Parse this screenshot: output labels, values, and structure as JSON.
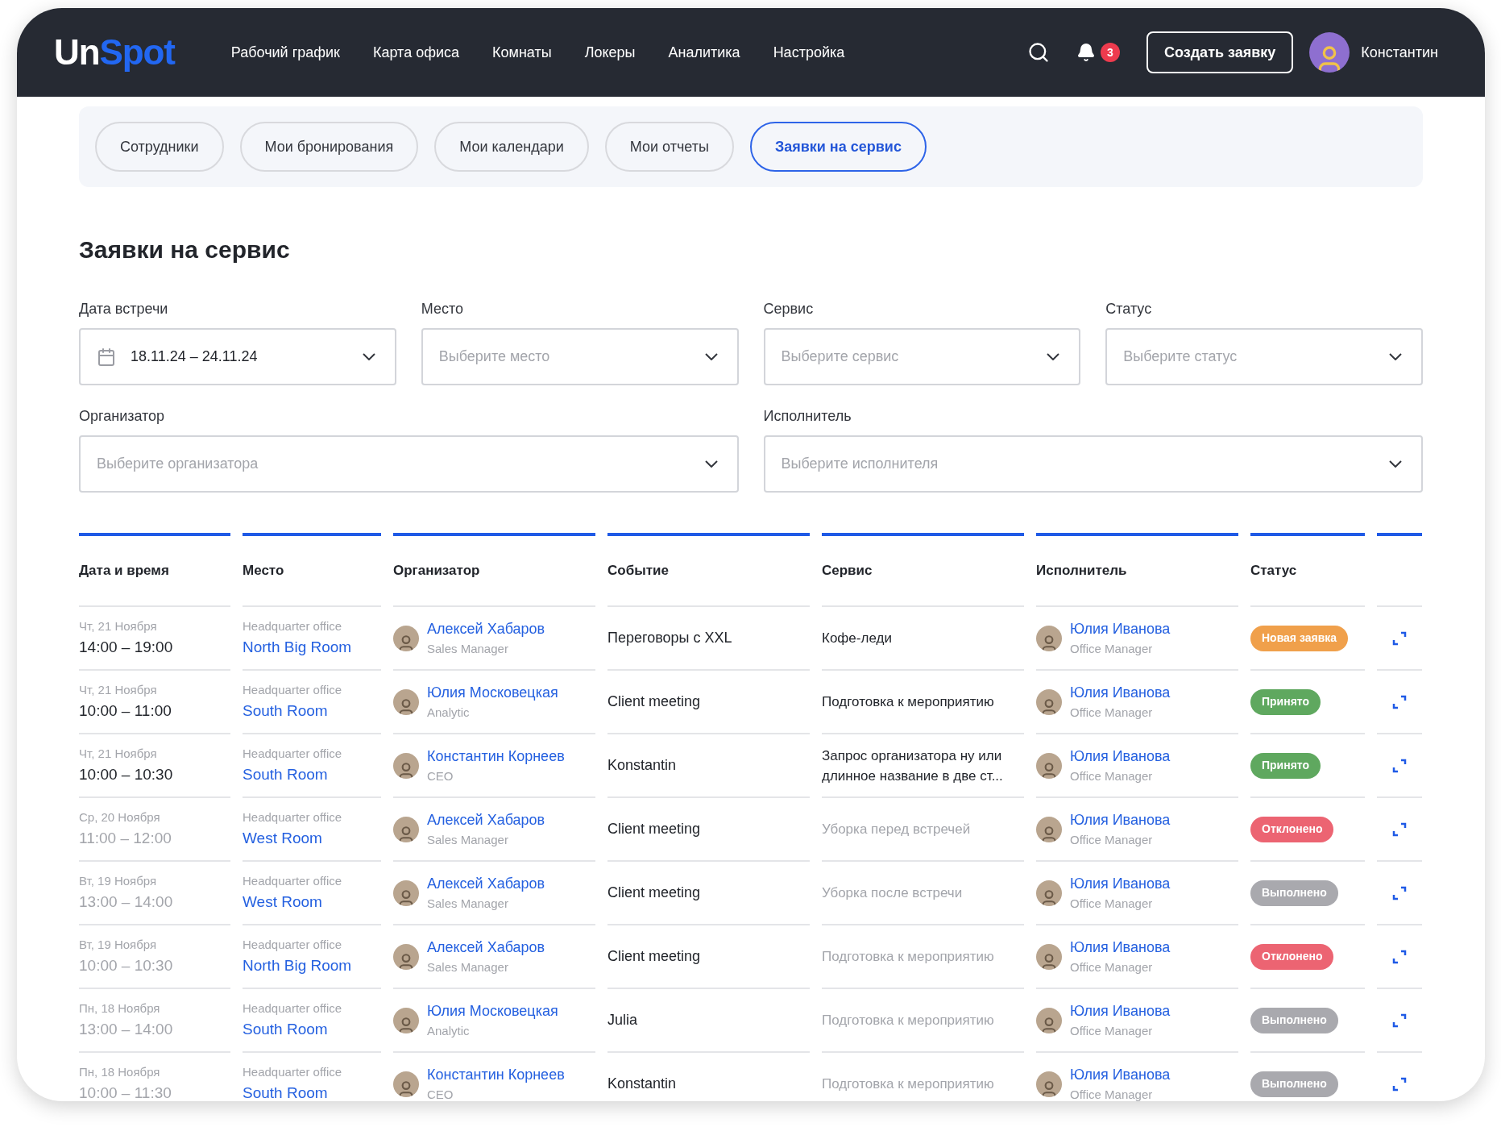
{
  "header": {
    "logo_start": "Un",
    "logo_end": "Spot",
    "nav": [
      "Рабочий график",
      "Карта офиса",
      "Комнаты",
      "Локеры",
      "Аналитика",
      "Настройка"
    ],
    "notification_count": "3",
    "create_button": "Создать заявку",
    "user_name": "Константин"
  },
  "tabs": [
    {
      "label": "Сотрудники",
      "selected": false
    },
    {
      "label": "Мои бронирования",
      "selected": false
    },
    {
      "label": "Мои календари",
      "selected": false
    },
    {
      "label": "Мои отчеты",
      "selected": false
    },
    {
      "label": "Заявки на сервис",
      "selected": true
    }
  ],
  "title": "Заявки на сервис",
  "filters": [
    {
      "label": "Дата встречи",
      "value": "18.11.24 – 24.11.24",
      "kind": "date"
    },
    {
      "label": "Место",
      "placeholder": "Выберите место",
      "kind": "select"
    },
    {
      "label": "Сервис",
      "placeholder": "Выберите сервис",
      "kind": "select"
    },
    {
      "label": "Статус",
      "placeholder": "Выберите статус",
      "kind": "select"
    },
    {
      "label": "Организатор",
      "placeholder": "Выберите организатора",
      "kind": "wide"
    },
    {
      "label": "Исполнитель",
      "placeholder": "Выберите исполнителя",
      "kind": "wide"
    }
  ],
  "table": {
    "columns": [
      "Дата и время",
      "Место",
      "Организатор",
      "Событие",
      "Сервис",
      "Исполнитель",
      "Статус"
    ],
    "rows": [
      {
        "muted": false,
        "day": "Чт, 21 Ноября",
        "time": "14:00 – 19:00",
        "office": "Headquarter office",
        "room": "North Big Room",
        "organizer": "Алексей Хабаров",
        "organizer_role": "Sales Manager",
        "event": "Переговоры с XXL",
        "service": "Кофе-леди",
        "executor": "Юлия Иванова",
        "executor_role": "Office Manager",
        "status": "Новая заявка",
        "color": "#f0a04b"
      },
      {
        "muted": false,
        "day": "Чт, 21 Ноября",
        "time": "10:00 – 11:00",
        "office": "Headquarter office",
        "room": "South Room",
        "organizer": "Юлия Московецкая",
        "organizer_role": "Analytic",
        "event": "Client meeting",
        "service": "Подготовка к мероприятию",
        "executor": "Юлия Иванова",
        "executor_role": "Office Manager",
        "status": "Принято",
        "color": "#5fa85f"
      },
      {
        "muted": false,
        "day": "Чт, 21 Ноября",
        "time": "10:00 – 10:30",
        "office": "Headquarter office",
        "room": "South Room",
        "organizer": "Константин Корнеев",
        "organizer_role": "CEO",
        "event": "Konstantin",
        "service": "Запрос организатора ну или длинное название в две ст...",
        "executor": "Юлия Иванова",
        "executor_role": "Office Manager",
        "status": "Принято",
        "color": "#5fa85f"
      },
      {
        "muted": true,
        "day": "Ср, 20 Ноября",
        "time": "11:00 – 12:00",
        "office": "Headquarter office",
        "room": "West Room",
        "organizer": "Алексей Хабаров",
        "organizer_role": "Sales Manager",
        "event": "Client meeting",
        "service": "Уборка перед встречей",
        "executor": "Юлия Иванова",
        "executor_role": "Office Manager",
        "status": "Отклонено",
        "color": "#ec6472"
      },
      {
        "muted": true,
        "day": "Вт, 19 Ноября",
        "time": "13:00 – 14:00",
        "office": "Headquarter office",
        "room": "West Room",
        "organizer": "Алексей Хабаров",
        "organizer_role": "Sales Manager",
        "event": "Client meeting",
        "service": "Уборка после встречи",
        "executor": "Юлия Иванова",
        "executor_role": "Office Manager",
        "status": "Выполнено",
        "color": "#a9a9ae"
      },
      {
        "muted": true,
        "day": "Вт, 19 Ноября",
        "time": "10:00 – 10:30",
        "office": "Headquarter office",
        "room": "North Big Room",
        "organizer": "Алексей Хабаров",
        "organizer_role": "Sales Manager",
        "event": "Client meeting",
        "service": "Подготовка к мероприятию",
        "executor": "Юлия Иванова",
        "executor_role": "Office Manager",
        "status": "Отклонено",
        "color": "#ec6472"
      },
      {
        "muted": true,
        "day": "Пн, 18 Ноября",
        "time": "13:00 – 14:00",
        "office": "Headquarter office",
        "room": "South Room",
        "organizer": "Юлия Московецкая",
        "organizer_role": "Analytic",
        "event": "Julia",
        "service": "Подготовка к мероприятию",
        "executor": "Юлия Иванова",
        "executor_role": "Office Manager",
        "status": "Выполнено",
        "color": "#a9a9ae"
      },
      {
        "muted": true,
        "day": "Пн, 18 Ноября",
        "time": "10:00 – 11:30",
        "office": "Headquarter office",
        "room": "South Room",
        "organizer": "Константин Корнеев",
        "organizer_role": "CEO",
        "event": "Konstantin",
        "service": "Подготовка к мероприятию",
        "executor": "Юлия Иванова",
        "executor_role": "Office Manager",
        "status": "Выполнено",
        "color": "#a9a9ae"
      }
    ]
  }
}
